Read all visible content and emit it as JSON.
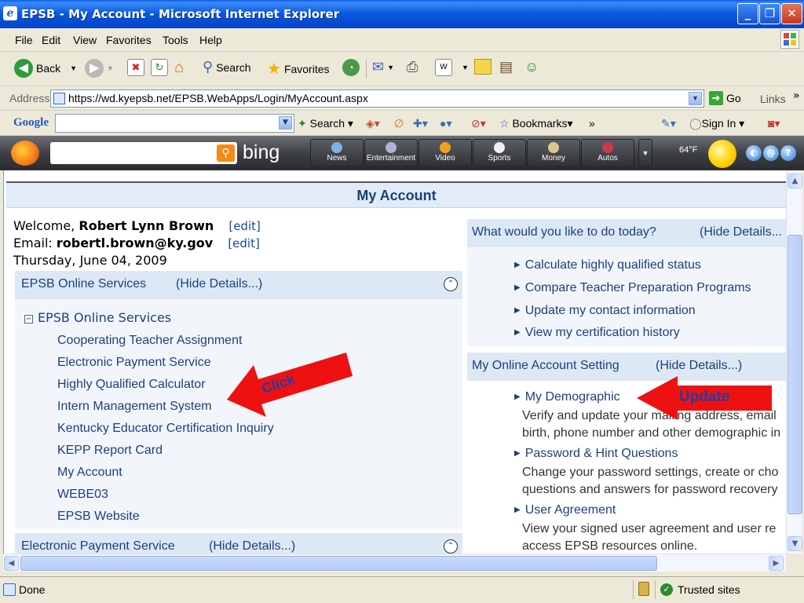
{
  "window": {
    "title": "EPSB - My Account - Microsoft Internet Explorer",
    "buttons": [
      "_",
      "❐",
      "✕"
    ]
  },
  "menu": [
    "File",
    "Edit",
    "View",
    "Favorites",
    "Tools",
    "Help"
  ],
  "toolbar": {
    "back": "Back",
    "search": "Search",
    "favorites": "Favorites"
  },
  "address": {
    "label": "Address",
    "url": "https://wd.kyepsb.net/EPSB.WebApps/Login/MyAccount.aspx",
    "go": "Go",
    "links": "Links"
  },
  "google": {
    "logo": "Google",
    "search": "Search",
    "bookmarks": "Bookmarks",
    "more": "»",
    "sign_in": "Sign In"
  },
  "bing": {
    "logo_text": "bing",
    "buttons": [
      "News",
      "Entertainment",
      "Video",
      "Sports",
      "Money",
      "Autos"
    ],
    "temperature": "64°F"
  },
  "page": {
    "title": "My Account",
    "welcome_label": "Welcome,",
    "user_name": "Robert Lynn Brown",
    "email_label": "Email:",
    "email": "robertl.brown@ky.gov",
    "edit": "[edit]",
    "date": "Thursday, June 04, 2009",
    "online_services_panel": {
      "title": "EPSB Online Services",
      "toggle": "(Hide Details...)",
      "tree_root": "EPSB Online Services",
      "items": [
        "Cooperating Teacher Assignment",
        "Electronic Payment Service",
        "Highly Qualified Calculator",
        "Intern Management System",
        "Kentucky Educator Certification Inquiry",
        "KEPP Report Card",
        "My Account",
        "WEBE03",
        "EPSB Website"
      ]
    },
    "payment_panel": {
      "title": "Electronic Payment Service",
      "toggle": "(Hide Details...)"
    },
    "todo_panel": {
      "title": "What would you like to do today?",
      "toggle": "(Hide Details...",
      "items": [
        "Calculate highly qualified status",
        "Compare Teacher Preparation Programs",
        "Update my contact information",
        "View my certification history"
      ]
    },
    "account_panel": {
      "title": "My Online Account Setting",
      "toggle": "(Hide Details...)",
      "items": [
        {
          "label": "My Demographic",
          "desc1": "Verify and update your mailing address, email",
          "desc2": "birth, phone number and other demographic in"
        },
        {
          "label": "Password & Hint Questions",
          "desc1": "Change your password settings, create or cho",
          "desc2": "questions and answers for password recovery"
        },
        {
          "label": "User Agreement",
          "desc1": "View your signed user agreement and user re",
          "desc2": "access EPSB resources online."
        }
      ]
    },
    "annotations": {
      "click": "Click",
      "update": "Update"
    }
  },
  "status": {
    "text": "Done",
    "zone": "Trusted sites"
  },
  "colors": {
    "title_bar": "#0b5de0",
    "panel_header": "#dde8f5",
    "link": "#1d3f7d",
    "annotation_arrow": "#ee1111",
    "annotation_text": "#1f3da8"
  }
}
